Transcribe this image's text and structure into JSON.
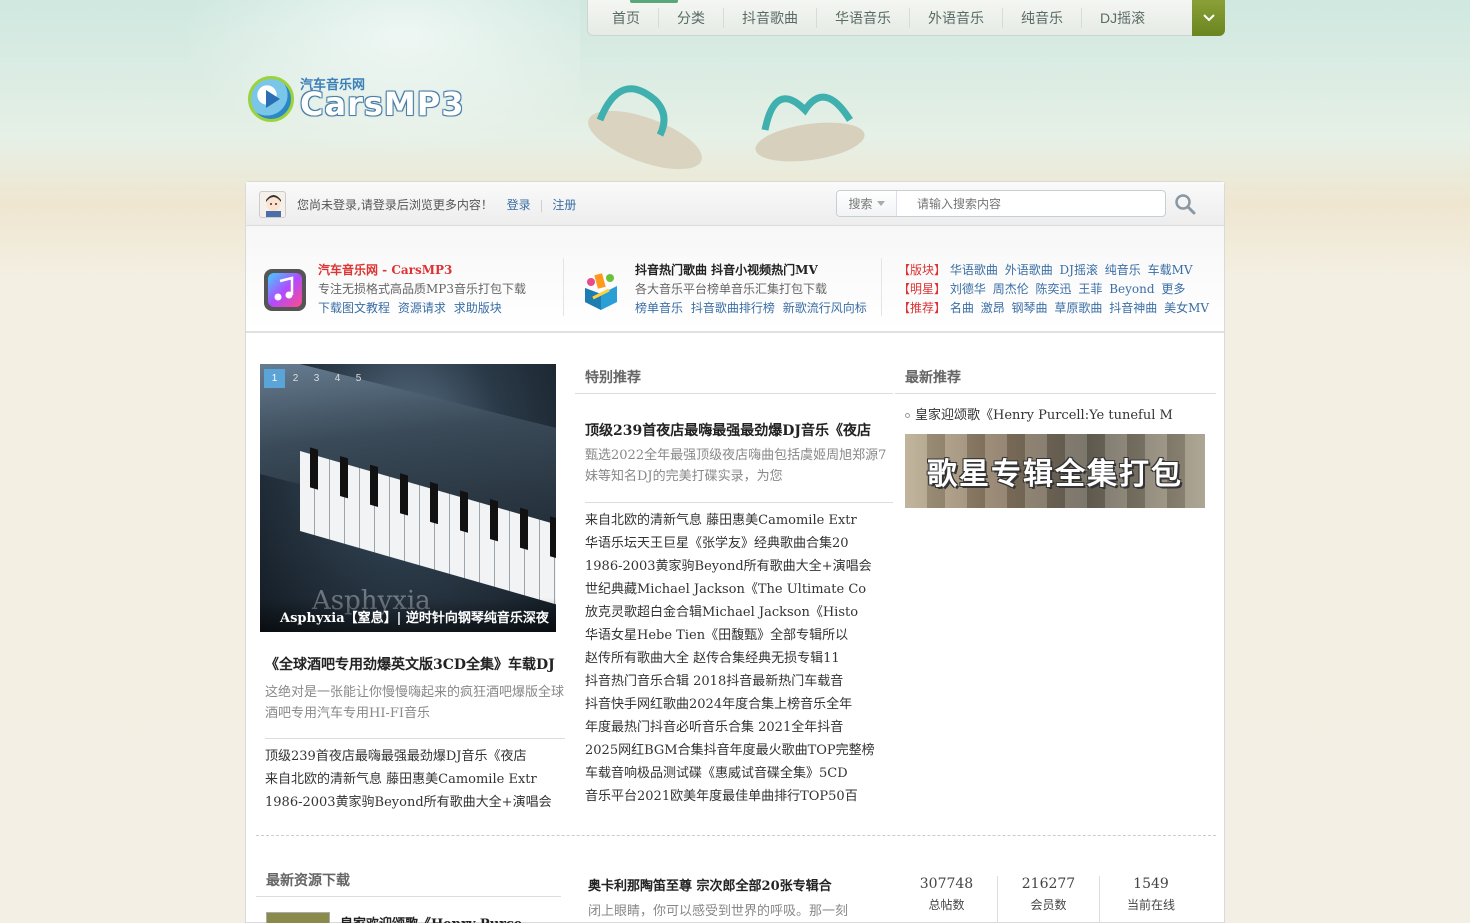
{
  "nav": {
    "items": [
      "首页",
      "分类",
      "抖音歌曲",
      "华语音乐",
      "外语音乐",
      "纯音乐",
      "DJ摇滚"
    ]
  },
  "logo": {
    "cn": "汽车音乐网",
    "en": "CarsMP3"
  },
  "userbar": {
    "message": "您尚未登录,请登录后浏览更多内容！",
    "login": "登录",
    "register": "注册"
  },
  "search": {
    "select": "搜索",
    "placeholder": "请输入搜索内容"
  },
  "info1": {
    "title": "汽车音乐网 - CarsMP3",
    "desc": "专注无损格式高品质MP3音乐打包下载",
    "links": [
      "下载图文教程",
      "资源请求",
      "求助版块"
    ]
  },
  "info2": {
    "title": "抖音热门歌曲 抖音小视频热门MV",
    "desc": "各大音乐平台榜单音乐汇集打包下载",
    "links": [
      "榜单音乐",
      "抖音歌曲排行榜",
      "新歌流行风向标"
    ]
  },
  "info3": {
    "rows": [
      {
        "tag": "【版块】",
        "links": [
          "华语歌曲",
          "外语歌曲",
          "DJ摇滚",
          "纯音乐",
          "车载MV"
        ]
      },
      {
        "tag": "【明星】",
        "links": [
          "刘德华",
          "周杰伦",
          "陈奕迅",
          "王菲",
          "Beyond",
          "更多"
        ]
      },
      {
        "tag": "【推荐】",
        "links": [
          "名曲",
          "激昂",
          "钢琴曲",
          "草原歌曲",
          "抖音神曲",
          "美女MV"
        ]
      }
    ]
  },
  "slider": {
    "pages": [
      "1",
      "2",
      "3",
      "4",
      "5"
    ],
    "active": "1",
    "image_text": "Asphyxia",
    "caption": "Asphyxia【窒息】| 逆时针向钢琴纯音乐深夜"
  },
  "feature_left": {
    "title": "《全球酒吧专用劲爆英文版3CD全集》车载DJ",
    "desc": "这绝对是一张能让你慢慢嗨起来的疯狂酒吧爆版全球酒吧专用汽车专用HI-FI音乐",
    "list": [
      "顶级239首夜店最嗨最强最劲爆DJ音乐《夜店",
      "来自北欧的清新气息 藤田惠美Camomile Extr",
      "1986-2003黄家驹Beyond所有歌曲大全+演唱会"
    ]
  },
  "special": {
    "heading": "特别推荐",
    "title": "顶级239首夜店最嗨最强最劲爆DJ音乐《夜店",
    "desc": "甄选2022全年最强顶级夜店嗨曲包括虞姬周旭郑源7妹等知名DJ的完美打碟实录，为您",
    "list": [
      "来自北欧的清新气息 藤田惠美Camomile Extr",
      "华语乐坛天王巨星《张学友》经典歌曲合集20",
      "1986-2003黄家驹Beyond所有歌曲大全+演唱会",
      "世纪典藏Michael Jackson《The Ultimate Co",
      "放克灵歌超白金合辑Michael Jackson《Histo",
      "华语女星Hebe Tien《田馥甄》全部专辑所以",
      "赵传所有歌曲大全 赵传合集经典无损专辑11",
      "抖音热门音乐合辑 2018抖音最新热门车载音",
      "抖音快手网红歌曲2024年度合集上榜音乐全年",
      "年度最热门抖音必听音乐合集 2021全年抖音",
      "2025网红BGM合集抖音年度最火歌曲TOP完整榜",
      "车载音响极品测试碟《惠威试音碟全集》5CD",
      "音乐平台2021欧美年度最佳单曲排行TOP50百"
    ]
  },
  "newest": {
    "heading": "最新推荐",
    "item": "皇家迎颂歌《Henry Purcell:Ye tuneful M",
    "banner": "歌星专辑全集打包"
  },
  "bottom": {
    "heading": "最新资源下载",
    "first_item": "皇家欢迎颂歌《Henry Purce",
    "mid_title": "奥卡利那陶笛至尊 宗次郎全部20张专辑合",
    "mid_desc": "闭上眼睛，你可以感受到世界的呼吸。那一刻",
    "stats": [
      {
        "value": "307748",
        "label": "总帖数"
      },
      {
        "value": "216277",
        "label": "会员数"
      },
      {
        "value": "1549",
        "label": "当前在线"
      }
    ]
  }
}
